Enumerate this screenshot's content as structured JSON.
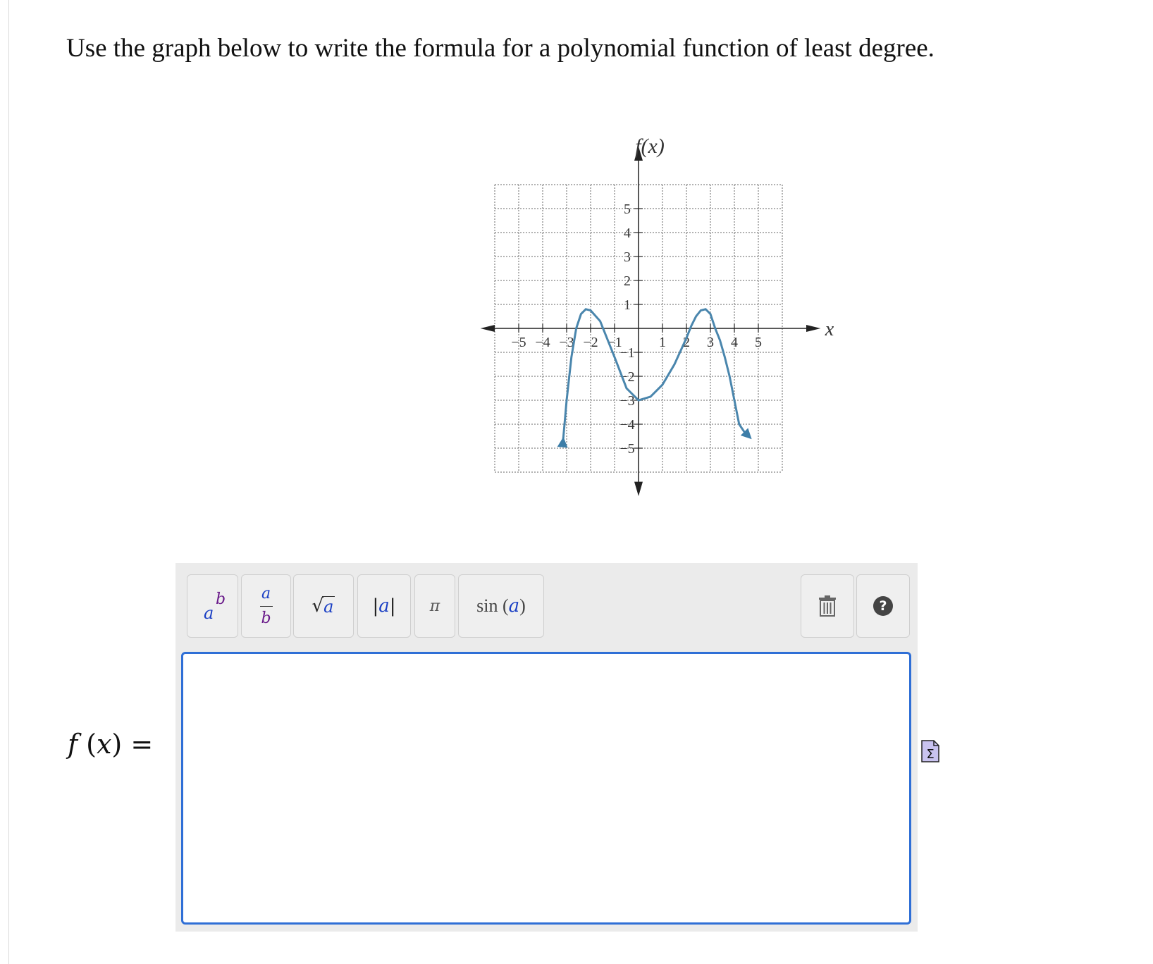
{
  "question": "Use the graph below to write the formula for a polynomial function of least degree.",
  "graph": {
    "y_axis_label": "f(x)",
    "x_axis_label": "x",
    "x_tick_labels": [
      "−5",
      "−4",
      "−3",
      "−2",
      "−1",
      "1",
      "2",
      "3",
      "4",
      "5"
    ],
    "y_tick_labels": [
      "5",
      "4",
      "3",
      "2",
      "1",
      "−1",
      "−2",
      "−3",
      "−4",
      "−5"
    ],
    "curve_color": "#4a86ad"
  },
  "chart_data": {
    "type": "line",
    "xlabel": "x",
    "ylabel": "f(x)",
    "xlim": [
      -5,
      5
    ],
    "ylim": [
      -5,
      5
    ],
    "grid": true,
    "x": [
      -3.15,
      -3.0,
      -2.8,
      -2.6,
      -2.4,
      -2.2,
      -2.0,
      -1.6,
      -1.0,
      -0.5,
      0.0,
      0.5,
      1.0,
      1.5,
      2.0,
      2.2,
      2.4,
      2.6,
      2.8,
      3.0,
      3.2,
      3.4,
      3.6,
      3.8,
      4.0,
      4.2,
      4.4,
      4.6
    ],
    "y": [
      -4.7,
      -3.0,
      -1.2,
      0.0,
      0.6,
      0.8,
      0.75,
      0.3,
      -1.2,
      -2.5,
      -3.0,
      -2.85,
      -2.35,
      -1.5,
      -0.4,
      0.1,
      0.5,
      0.75,
      0.8,
      0.6,
      0.0,
      -0.5,
      -1.2,
      -2.0,
      -3.0,
      -4.0,
      -4.3,
      -4.5
    ]
  },
  "toolbar": {
    "power": {
      "base": "a",
      "exponent": "b"
    },
    "fraction": {
      "numerator": "a",
      "denominator": "b"
    },
    "sqrt": {
      "symbol": "√",
      "argument": "a"
    },
    "abs": {
      "argument": "a"
    },
    "pi": "π",
    "sin": {
      "func": "sin",
      "argument": "a"
    }
  },
  "answer": {
    "label_func": "f",
    "label_var": "x",
    "value": ""
  }
}
